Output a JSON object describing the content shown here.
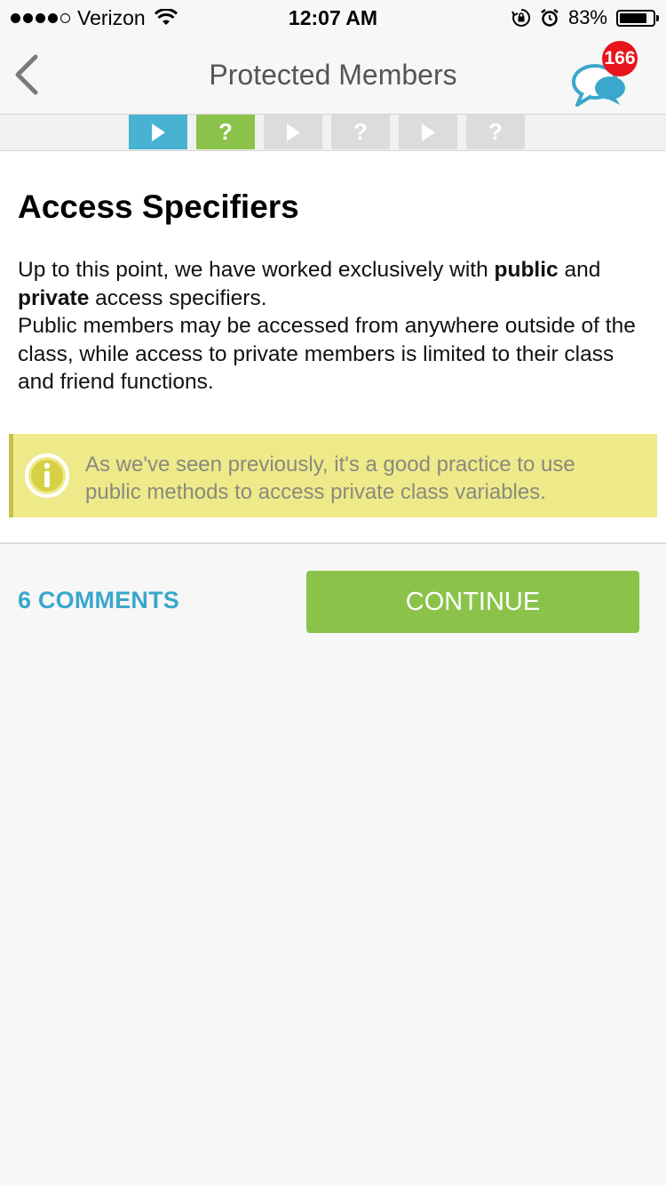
{
  "status_bar": {
    "carrier": "Verizon",
    "time": "12:07 AM",
    "battery_percent": "83%",
    "battery_level": 0.83,
    "signal_bars": 4
  },
  "header": {
    "title": "Protected Members",
    "chat_badge": "166"
  },
  "progress_steps": [
    {
      "type": "play-icon",
      "color": "#48b2d3"
    },
    {
      "type": "question",
      "label": "?",
      "color": "#8bc34a"
    },
    {
      "type": "play-icon",
      "color": "#dcdcdc"
    },
    {
      "type": "question",
      "label": "?",
      "color": "#dcdcdc"
    },
    {
      "type": "play-icon",
      "color": "#dcdcdc"
    },
    {
      "type": "question",
      "label": "?",
      "color": "#dcdcdc"
    }
  ],
  "lesson": {
    "heading": "Access Specifiers",
    "p1_a": "Up to this point, we have worked exclusively with ",
    "p1_bold1": "public",
    "p1_b": " and ",
    "p1_bold2": "private",
    "p1_c": " access specifiers.",
    "p2": "Public members may be accessed from anywhere outside of the class, while access to private members is limited to their class and friend functions.",
    "note": "As we've seen previously, it's a good practice to use public methods to access private class variables."
  },
  "actions": {
    "comments": "6 COMMENTS",
    "continue": "CONTINUE"
  },
  "colors": {
    "accent_blue": "#3aa7cc",
    "accent_green": "#8bc34a",
    "note_bg": "#eeea8a",
    "badge_red": "#e8141b"
  }
}
